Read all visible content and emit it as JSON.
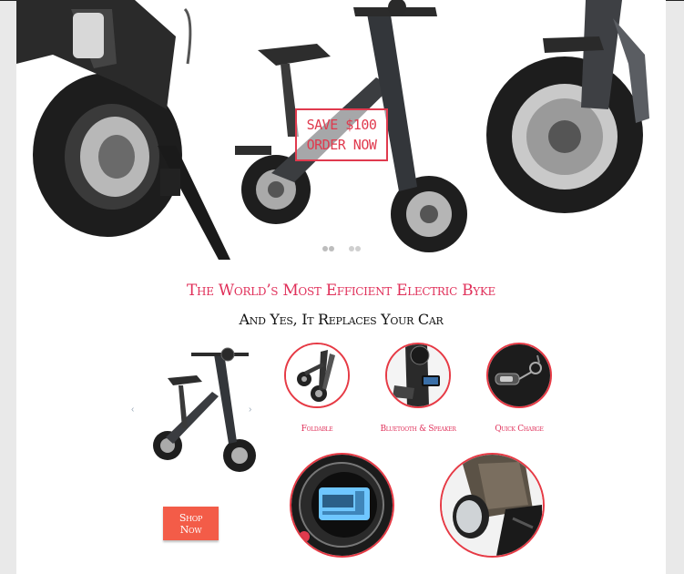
{
  "hero": {
    "promo_line1": "SAVE $100",
    "promo_line2": "ORDER NOW",
    "slides_count": 2,
    "active_slide": 1
  },
  "headline": "The World’s Most Efficient Electric Byke",
  "subheadline": "And Yes, It Replaces Your Car",
  "carousel": {
    "prev_icon": "‹",
    "next_icon": "›"
  },
  "shop_button": "Shop Now",
  "features": [
    {
      "label": "Foldable",
      "icon": "folded-bike-icon"
    },
    {
      "label": "Bluetooth & Speaker",
      "icon": "speaker-icon"
    },
    {
      "label": "Quick Charge",
      "icon": "key-fob-icon"
    }
  ],
  "colors": {
    "accent": "#e0305a",
    "button": "#f35c48",
    "circle_border": "#e63a45"
  }
}
